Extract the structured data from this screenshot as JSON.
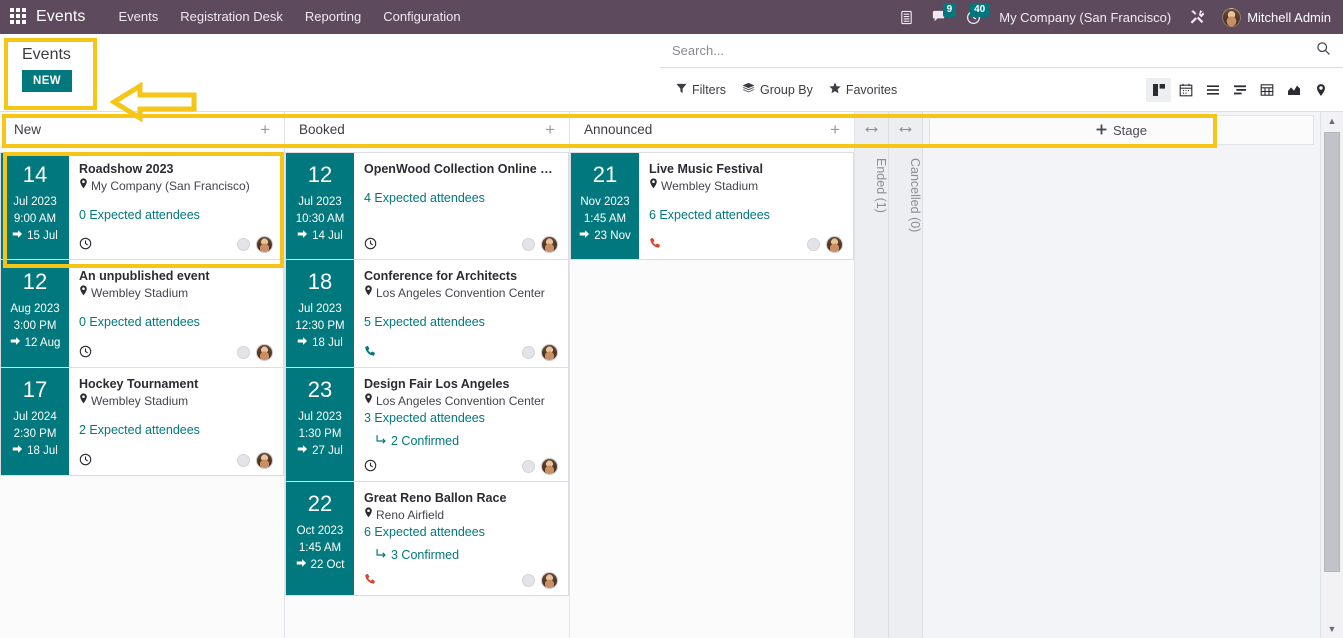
{
  "navbar": {
    "apps_icon": "apps-grid-icon",
    "brand": "Events",
    "menu": [
      {
        "label": "Events"
      },
      {
        "label": "Registration Desk"
      },
      {
        "label": "Reporting"
      },
      {
        "label": "Configuration"
      }
    ],
    "sys_icons": [
      {
        "name": "voip-phone-icon",
        "glyph": "☏",
        "badge": null
      },
      {
        "name": "messages-icon",
        "glyph": "💬",
        "badge": "9"
      },
      {
        "name": "activities-clock-icon",
        "glyph": "◴",
        "badge": "40"
      }
    ],
    "company": "My Company (San Francisco)",
    "debug_icon": "tools-icon",
    "user_name": "Mitchell Admin",
    "avatar_name": "user-avatar"
  },
  "control_panel": {
    "breadcrumb": "Events",
    "new_button": "NEW",
    "search": {
      "placeholder": "Search...",
      "value": ""
    },
    "filters": [
      {
        "name": "filters",
        "label": "Filters",
        "icon": "funnel-icon"
      },
      {
        "name": "group-by",
        "label": "Group By",
        "icon": "layers-icon"
      },
      {
        "name": "favorites",
        "label": "Favorites",
        "icon": "star-icon"
      }
    ],
    "views": [
      {
        "name": "kanban-view",
        "label": "Kanban",
        "active": true
      },
      {
        "name": "calendar-view",
        "label": "Calendar",
        "active": false
      },
      {
        "name": "list-view",
        "label": "List",
        "active": false
      },
      {
        "name": "gantt-view",
        "label": "Gantt",
        "active": false
      },
      {
        "name": "pivot-view",
        "label": "Pivot",
        "active": false
      },
      {
        "name": "graph-view",
        "label": "Graph",
        "active": false
      },
      {
        "name": "map-view",
        "label": "Map",
        "active": false
      }
    ]
  },
  "kanban": {
    "add_stage_label": "Stage",
    "columns": [
      {
        "title": "New",
        "add_label": "+",
        "cards": [
          {
            "day": "14",
            "month_year": "Jul 2023",
            "time": "9:00 AM",
            "end": "15 Jul",
            "title": "Roadshow 2023",
            "location": "My Company (San Francisco)",
            "attendees": "0 Expected attendees",
            "confirmed": null,
            "activity_icon": "clock-icon",
            "activity_color": "clock",
            "highlighted": true
          },
          {
            "day": "12",
            "month_year": "Aug 2023",
            "time": "3:00 PM",
            "end": "12 Aug",
            "title": "An unpublished event",
            "location": "Wembley Stadium",
            "attendees": "0 Expected attendees",
            "confirmed": null,
            "activity_icon": "clock-icon",
            "activity_color": "clock",
            "highlighted": false
          },
          {
            "day": "17",
            "month_year": "Jul 2024",
            "time": "2:30 PM",
            "end": "18 Jul",
            "title": "Hockey Tournament",
            "location": "Wembley Stadium",
            "attendees": "2 Expected attendees",
            "confirmed": null,
            "activity_icon": "clock-icon",
            "activity_color": "clock",
            "highlighted": false
          }
        ]
      },
      {
        "title": "Booked",
        "add_label": "+",
        "cards": [
          {
            "day": "12",
            "month_year": "Jul 2023",
            "time": "10:30 AM",
            "end": "14 Jul",
            "title": "OpenWood Collection Online R...",
            "location": "",
            "attendees": "4 Expected attendees",
            "confirmed": null,
            "activity_icon": "clock-icon",
            "activity_color": "clock",
            "highlighted": false
          },
          {
            "day": "18",
            "month_year": "Jul 2023",
            "time": "12:30 PM",
            "end": "18 Jul",
            "title": "Conference for Architects",
            "location": "Los Angeles Convention Center",
            "attendees": "5 Expected attendees",
            "confirmed": null,
            "activity_icon": "phone-icon",
            "activity_color": "phone-teal",
            "highlighted": false
          },
          {
            "day": "23",
            "month_year": "Jul 2023",
            "time": "1:30 PM",
            "end": "27 Jul",
            "title": "Design Fair Los Angeles",
            "location": "Los Angeles Convention Center",
            "attendees": "3 Expected attendees",
            "confirmed": "2 Confirmed",
            "activity_icon": "clock-icon",
            "activity_color": "clock",
            "highlighted": false
          },
          {
            "day": "22",
            "month_year": "Oct 2023",
            "time": "1:45 AM",
            "end": "22 Oct",
            "title": "Great Reno Ballon Race",
            "location": "Reno Airfield",
            "attendees": "6 Expected attendees",
            "confirmed": "3 Confirmed",
            "activity_icon": "phone-icon",
            "activity_color": "phone-red",
            "highlighted": false
          }
        ]
      },
      {
        "title": "Announced",
        "add_label": "+",
        "cards": [
          {
            "day": "21",
            "month_year": "Nov 2023",
            "time": "1:45 AM",
            "end": "23 Nov",
            "title": "Live Music Festival",
            "location": "Wembley Stadium",
            "attendees": "6 Expected attendees",
            "confirmed": null,
            "activity_icon": "phone-icon",
            "activity_color": "phone-red",
            "highlighted": false
          }
        ]
      }
    ],
    "collapsed_columns": [
      {
        "label": "Ended (1)"
      },
      {
        "label": "Cancelled (0)"
      }
    ]
  },
  "annotations": {
    "highlight_color": "#f5c518",
    "accent_color": "#00787d",
    "navbar_color": "#5d4a5d",
    "arrow_direction": "left"
  }
}
